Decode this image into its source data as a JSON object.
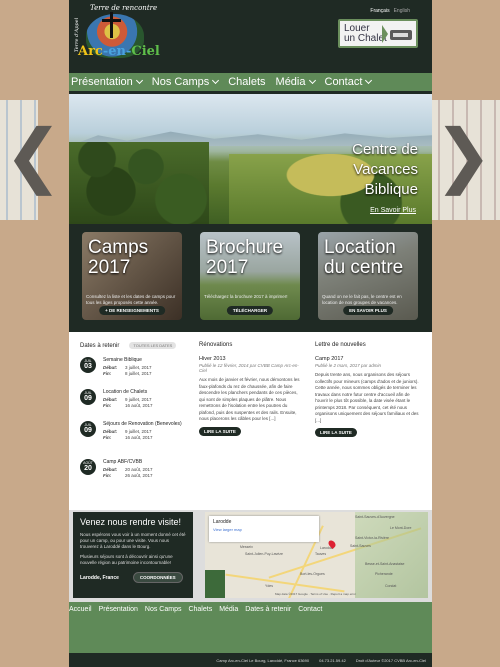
{
  "header": {
    "logo": {
      "tagline": "Terre de rencontre",
      "side_text": "Terre d'Appel",
      "name": [
        "Arc",
        "-en-",
        "Ciel"
      ]
    },
    "languages": {
      "active": "Français",
      "other": "English"
    },
    "chalet_cta": {
      "line1": "Louer",
      "line2": "un Chalet"
    }
  },
  "nav": {
    "items": [
      {
        "label": "Présentation",
        "has_dropdown": true
      },
      {
        "label": "Nos Camps",
        "has_dropdown": true
      },
      {
        "label": "Chalets",
        "has_dropdown": false
      },
      {
        "label": "Média",
        "has_dropdown": true
      },
      {
        "label": "Contact",
        "has_dropdown": true
      }
    ]
  },
  "hero": {
    "title_lines": [
      "Centre de",
      "Vacances",
      "Biblique"
    ],
    "more_link": "En Savoir Plus",
    "prev_glyph": "❮",
    "next_glyph": "❯"
  },
  "cards": [
    {
      "title_lines": [
        "Camps",
        "2017"
      ],
      "text": "Consultez la liste et les dates de camps pour tous les âges proposés cette année.",
      "button": "+ DE RENSEIGNEMENTS",
      "bg": "#5a4a3a"
    },
    {
      "title_lines": [
        "Brochure",
        "2017"
      ],
      "text": "Téléchargez la brochure 2017 à imprimer!",
      "button": "TÉLÉCHARGER",
      "bg": "#7a8a6a"
    },
    {
      "title_lines": [
        "Location",
        "du centre"
      ],
      "text": "Quand on ne le fait pas, le centre est en location de nos groupes de vacances.",
      "button": "EN SAVOIR PLUS",
      "bg": "#6a6a60"
    }
  ],
  "dates": {
    "heading": "Dates à retenir",
    "all_label": "TOUTES LES DATES",
    "start_label": "Début:",
    "end_label": "Fin:",
    "events": [
      {
        "month": "JUIL",
        "day": "03",
        "title": "Semaine Biblique",
        "start": "3 juillet, 2017",
        "end": "8 juillet, 2017"
      },
      {
        "month": "JUIL",
        "day": "09",
        "title": "Location de Chalets",
        "start": "9 juillet, 2017",
        "end": "16 août, 2017"
      },
      {
        "month": "JUIL",
        "day": "09",
        "title": "Séjours de Renovation (Benevoles)",
        "start": "9 juillet, 2017",
        "end": "16 août, 2017"
      },
      {
        "month": "AOÛT",
        "day": "20",
        "title": "Camp ABF/CVBB",
        "start": "20 août, 2017",
        "end": "26 août, 2017"
      }
    ]
  },
  "renovations": {
    "heading": "Rénovations",
    "post_title": "Hiver 2013",
    "post_meta": "Publié le 12 février, 2014 par CVBB Camp Arc-en-Ciel",
    "post_body": "Aux mois de janvier et février, nous démontons les faux-plafonds du rez de chaussée, afin de faire descendre les planchers pendants de ces pièces, qui sont de simples plaques de plâtre. Nous remettrons de l'isolation entre les poutres du plafond, puis des suspentes et des rails. Ensuite, nous placerons les câbles pour les [...]",
    "button": "LIRE LA SUITE"
  },
  "newsletter": {
    "heading": "Lettre de nouvelles",
    "post_title": "Camp 2017",
    "post_meta": "Publié le 2 mars, 2017 par admin",
    "post_body": "Depuis trente ans, nous organisons des séjours collectifs pour mineurs (camps d'ados et de juniors). Cette année, nous sommes obligés de terminer les travaux dans notre futur centre d'accueil afin de l'ouvrir le plus tôt possible, la date visée étant le printemps 2018. Par conséquent, cet été nous organisons uniquement des séjours familiaux et des [...]",
    "button": "LIRE LA SUITE"
  },
  "visit": {
    "heading": "Venez nous rendre visite!",
    "p1": "Nous espérons vous voir à un moment donné cet été pour un camp, ou pour une visite. Vous nous trouverez à Laroddé dans le Bourg.",
    "p2": "Plusieurs séjours sont à découvrir ainsi qu'une nouvelle région au patrimoine incontournable!",
    "location": "Larodde, France",
    "coord_button": "COORDONNÉES"
  },
  "map": {
    "card_title": "Larodde",
    "card_link": "View larger map",
    "labels": [
      "Saint-Sauves-d'Auvergne",
      "Le Mont-Dore",
      "Saint-Victor-la-Rivière",
      "Saint-Sauves",
      "Messeix",
      "Saint-Julien-Puy-Lavèze",
      "Tauves",
      "Larodde",
      "Bort-les-Orgues",
      "Besse-et-Saint-Anastaise",
      "Picherande",
      "Ydes",
      "Condat"
    ],
    "footer": "Map data ©2017 Google · Terms of Use · Report a map error"
  },
  "footer": {
    "nav": [
      "Accueil",
      "Présentation",
      "Nos Camps",
      "Chalets",
      "Média",
      "Dates à retenir",
      "Contact"
    ],
    "address": "Camp Arc-en-Ciel Le Bourg, Laroddé, France 63690",
    "phone": "04.73.21.59.42",
    "copyright": "Droit d'Auteur ©2017 CVBB Arc-en-Ciel"
  },
  "colors": {
    "dark": "#1f2a24",
    "green": "#5f8a58",
    "bg": "#c8a98a"
  }
}
